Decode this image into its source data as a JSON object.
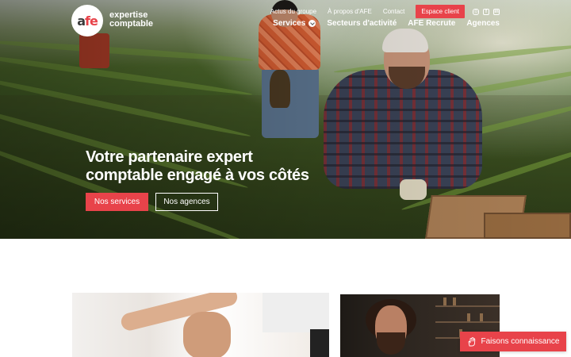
{
  "brand": {
    "logo_mark_a": "a",
    "logo_mark_fe": "fe",
    "name_line1": "expertise",
    "name_line2": "comptable"
  },
  "topbar": {
    "links": [
      "Actus du groupe",
      "À propos d'AFE",
      "Contact"
    ],
    "client_button": "Espace client",
    "social": [
      {
        "icon": "instagram-icon",
        "glyph": "◎"
      },
      {
        "icon": "facebook-icon",
        "glyph": "f"
      },
      {
        "icon": "linkedin-icon",
        "glyph": "in"
      }
    ]
  },
  "mainnav": {
    "items": [
      "Services",
      "Secteurs d'activité",
      "AFE Recrute",
      "Agences"
    ]
  },
  "hero": {
    "title_line1": "Votre partenaire expert",
    "title_line2": "comptable engagé à vos côtés",
    "primary_button": "Nos services",
    "secondary_button": "Nos agences"
  },
  "floating_cta": {
    "label": "Faisons connaissance",
    "icon": "waving-hand-icon"
  },
  "colors": {
    "accent": "#e8434a",
    "white": "#ffffff"
  }
}
